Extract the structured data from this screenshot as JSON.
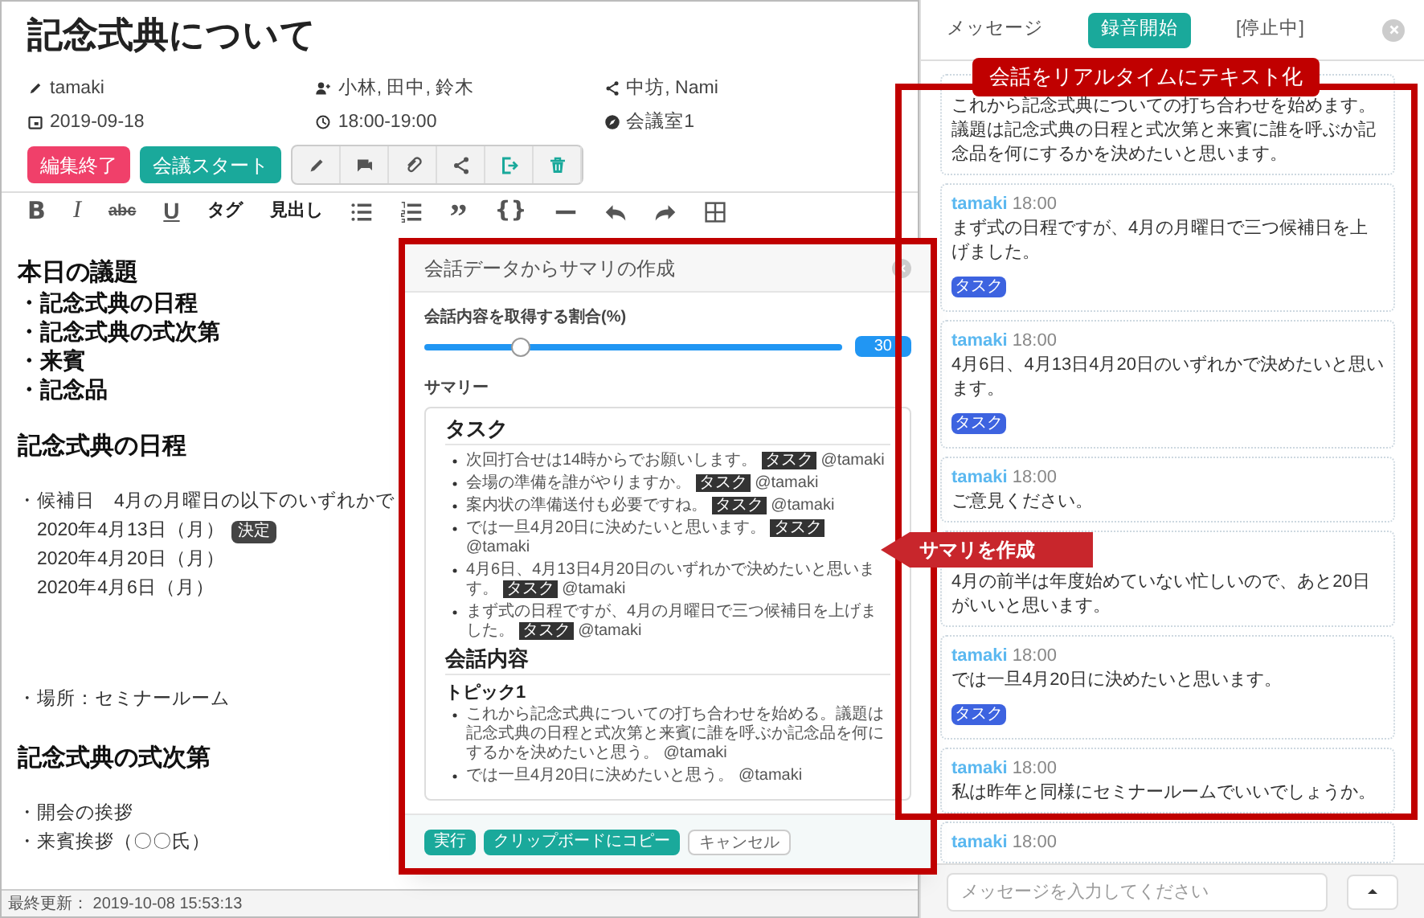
{
  "editor": {
    "title": "記念式典について",
    "meta": [
      {
        "text": "tamaki"
      },
      {
        "text": "小林, 田中, 鈴木"
      },
      {
        "text": "中坊, Nami"
      },
      {
        "text": "2019-09-18"
      },
      {
        "text": "18:00-19:00"
      },
      {
        "text": "会議室1"
      }
    ],
    "buttons": [
      {
        "label": "編集終了",
        "color": "#f0406a"
      },
      {
        "label": "会議スタート",
        "color": "#1aa99b"
      }
    ],
    "toolbar": [
      "B",
      "I",
      "abc",
      "U",
      "タグ",
      "見出し",
      "”",
      "{}"
    ],
    "content": [
      {
        "kind": "gap"
      },
      {
        "kind": "heading",
        "text": "本日の議題"
      },
      {
        "kind": "item",
        "text": "・記念式典の日程"
      },
      {
        "kind": "item",
        "text": "・記念式典の式次第"
      },
      {
        "kind": "item",
        "text": "・来賓"
      },
      {
        "kind": "item",
        "text": "・記念品"
      },
      {
        "kind": "gap"
      },
      {
        "kind": "heading",
        "text": "記念式典の日程"
      },
      {
        "kind": "gap"
      },
      {
        "kind": "line",
        "text": "・候補日　4月の月曜日の以下のいずれかで"
      },
      {
        "kind": "line",
        "text": "　2020年4月13日（月）",
        "badge": "決定"
      },
      {
        "kind": "line",
        "text": "　2020年4月20日（月）"
      },
      {
        "kind": "line",
        "text": "　2020年4月6日（月）"
      },
      {
        "kind": "gap"
      },
      {
        "kind": "gap"
      },
      {
        "kind": "gap"
      },
      {
        "kind": "line",
        "text": "・場所：セミナールーム"
      },
      {
        "kind": "gap"
      },
      {
        "kind": "heading",
        "text": "記念式典の式次第"
      },
      {
        "kind": "gap"
      },
      {
        "kind": "line",
        "text": "・開会の挨拶"
      },
      {
        "kind": "line",
        "text": "・来賓挨拶（〇〇氏）"
      }
    ],
    "status": "最終更新： 2019-10-08 15:53:13"
  },
  "dialog": {
    "title": "会話データからサマリの作成",
    "slider_label": "会話内容を取得する割合(%)",
    "slider": {
      "level": 0.23,
      "reading": "30"
    },
    "summary_label": "サマリー",
    "summary": [
      {
        "kind": "h1",
        "text": "タスク"
      },
      {
        "kind": "li",
        "text": "次回打合せは14時からでお願いします。",
        "tag": "タスク",
        "user": "@tamaki"
      },
      {
        "kind": "li",
        "text": "会場の準備を誰がやりますか。",
        "tag": "タスク",
        "user": "@tamaki"
      },
      {
        "kind": "li",
        "text": "案内状の準備送付も必要ですね。",
        "tag": "タスク",
        "user": "@tamaki"
      },
      {
        "kind": "li",
        "text": "では一旦4月20日に決めたいと思います。",
        "tag": "タスク",
        "user": "@tamaki"
      },
      {
        "kind": "li",
        "text": "4月6日、4月13日4月20日のいずれかで決めたいと思います。",
        "tag": "タスク",
        "user": "@tamaki"
      },
      {
        "kind": "li",
        "text": "まず式の日程ですが、4月の月曜日で三つ候補日を上げました。",
        "tag": "タスク",
        "user": "@tamaki"
      },
      {
        "kind": "h1",
        "text": "会話内容"
      },
      {
        "kind": "h2",
        "text": "トピック1"
      },
      {
        "kind": "li",
        "text": "これから記念式典についての打ち合わせを始める。議題は記念式典の日程と式次第と来賓に誰を呼ぶか記念品を何にするかを決めたいと思う。",
        "user": "@tamaki"
      },
      {
        "kind": "li",
        "text": "では一旦4月20日に決めたいと思う。",
        "user": "@tamaki"
      }
    ],
    "buttons": [
      {
        "label": "実行",
        "kind": "primary"
      },
      {
        "label": "クリップボードにコピー",
        "kind": "primary"
      },
      {
        "label": "キャンセル",
        "kind": "plain"
      }
    ]
  },
  "chat": {
    "tab": "メッセージ",
    "record_button": "録音開始",
    "state": "[停止中]",
    "messages": [
      {
        "text": "これから記念式典についての打ち合わせを始めます。議題は記念式典の日程と式次第と来賓に誰を呼ぶか記念品を何にするかを決めたいと思います。"
      },
      {
        "author": "tamaki",
        "time": "18:00",
        "text": "まず式の日程ですが、4月の月曜日で三つ候補日を上げました。",
        "tag": "タスク"
      },
      {
        "author": "tamaki",
        "time": "18:00",
        "text": "4月6日、4月13日4月20日のいずれかで決めたいと思います。",
        "tag": "タスク"
      },
      {
        "author": "tamaki",
        "time": "18:00",
        "text": "ご意見ください。"
      },
      {
        "text": "4月の前半は年度始めていない忙しいので、あと20日がいいと思います。"
      },
      {
        "author": "tamaki",
        "time": "18:00",
        "text": "では一旦4月20日に決めたいと思います。",
        "tag": "タスク"
      },
      {
        "author": "tamaki",
        "time": "18:00",
        "text": "私は昨年と同様にセミナールームでいいでしょうか。"
      },
      {
        "author": "tamaki",
        "time": "18:00"
      }
    ],
    "input": {
      "placeholder": "メッセージを入力してください"
    }
  },
  "annotations": [
    {
      "kind": "label",
      "text": "会話をリアルタイムにテキスト化"
    },
    {
      "kind": "arrow",
      "text": "サマリを作成"
    }
  ]
}
